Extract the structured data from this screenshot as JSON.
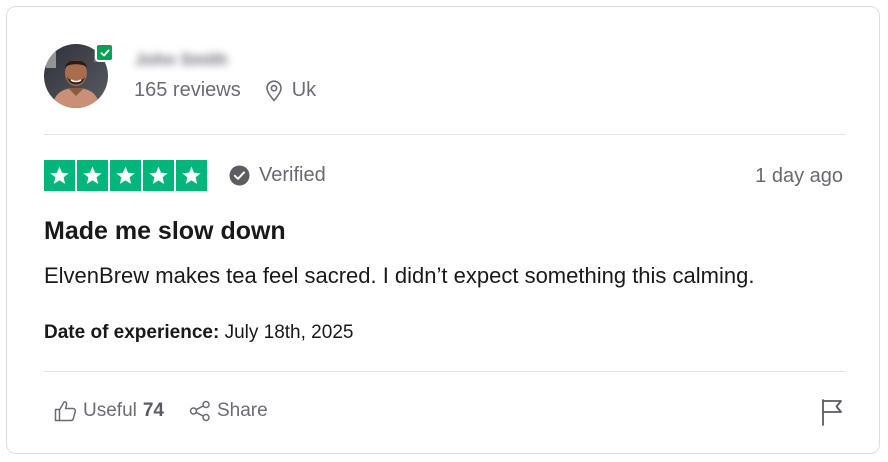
{
  "reviewer": {
    "name": "John Smith",
    "review_count": "165 reviews",
    "location": "Uk",
    "avatar_icon": "person-photo-icon",
    "verified_badge_icon": "check-badge-icon"
  },
  "rating": {
    "stars": 5,
    "max_stars": 5,
    "star_color": "#00b67a",
    "verified_label": "Verified",
    "date": "1 day ago"
  },
  "review": {
    "title": "Made me slow down",
    "body": "ElvenBrew makes tea feel sacred. I didn’t expect something this calming.",
    "experience_label": "Date of experience:",
    "experience_date": "July 18th, 2025"
  },
  "actions": {
    "useful_label": "Useful",
    "useful_count": "74",
    "share_label": "Share",
    "useful_icon": "thumbs-up-icon",
    "share_icon": "share-icon",
    "flag_icon": "flag-icon"
  },
  "colors": {
    "brand_green": "#00b67a",
    "badge_green": "#04a156",
    "muted_text": "#6b6b78"
  }
}
